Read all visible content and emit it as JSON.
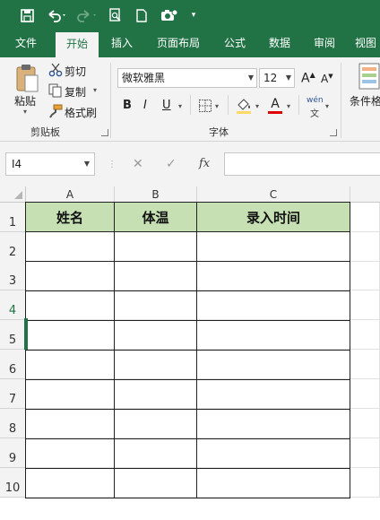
{
  "quick_access": {
    "icons": [
      "save-icon",
      "undo-icon",
      "redo-icon",
      "print-preview-icon",
      "new-file-icon",
      "camera-icon",
      "customize-icon"
    ]
  },
  "tabs": [
    {
      "label": "文件"
    },
    {
      "label": "开始"
    },
    {
      "label": "插入"
    },
    {
      "label": "页面布局"
    },
    {
      "label": "公式"
    },
    {
      "label": "数据"
    },
    {
      "label": "审阅"
    },
    {
      "label": "视图"
    }
  ],
  "ribbon": {
    "clipboard": {
      "paste_label": "粘贴",
      "cut_label": "剪切",
      "copy_label": "复制",
      "format_painter_label": "格式刷",
      "group_label": "剪贴板"
    },
    "font": {
      "font_name": "微软雅黑",
      "font_size": "12",
      "grow_label": "A",
      "shrink_label": "A",
      "bold": "B",
      "italic": "I",
      "underline": "U",
      "font_color_letter": "A",
      "phonetic_label": "wén",
      "group_label": "字体"
    },
    "styles": {
      "conditional_label": "条件格"
    }
  },
  "formula_bar": {
    "name_box": "I4",
    "cancel_icon": "✕",
    "enter_icon": "✓",
    "fx_label": "fx",
    "formula": ""
  },
  "sheet": {
    "columns": [
      "A",
      "B",
      "C"
    ],
    "rows": [
      "1",
      "2",
      "3",
      "4",
      "5",
      "6",
      "7",
      "8",
      "9",
      "10"
    ],
    "headers": [
      "姓名",
      "体温",
      "录入时间"
    ],
    "accent": "#217346",
    "header_fill": "#c6e0b4"
  }
}
